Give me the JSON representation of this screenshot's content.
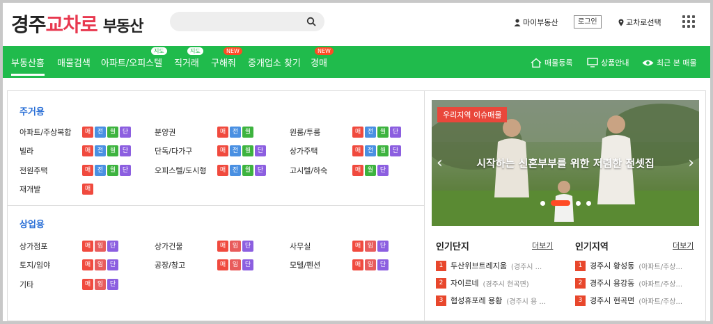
{
  "header": {
    "logo_part1": "경주",
    "logo_part2": "교차로",
    "logo_part3": "부동산",
    "search_placeholder": "",
    "my_realestate": "마이부동산",
    "login": "로그인",
    "region_select": "교차로선택"
  },
  "nav": {
    "items": [
      {
        "label": "부동산홈"
      },
      {
        "label": "매물검색"
      },
      {
        "label": "아파트/오피스텔",
        "badge": "지도"
      },
      {
        "label": "직거래",
        "badge": "지도"
      },
      {
        "label": "구해줘",
        "badge": "NEW"
      },
      {
        "label": "중개업소 찾기"
      },
      {
        "label": "경매",
        "badge": "NEW"
      }
    ],
    "right": {
      "register": "매물등록",
      "product_info": "상품안내",
      "recent": "최근 본 매물"
    }
  },
  "residential": {
    "title": "주거용",
    "items": [
      {
        "label": "아파트/주상복합",
        "tags": [
          "매",
          "전",
          "월",
          "단"
        ]
      },
      {
        "label": "분양권",
        "tags": [
          "매",
          "전",
          "월"
        ]
      },
      {
        "label": "원룸/투룸",
        "tags": [
          "매",
          "전",
          "월",
          "단"
        ]
      },
      {
        "label": "빌라",
        "tags": [
          "매",
          "전",
          "월",
          "단"
        ]
      },
      {
        "label": "단독/다가구",
        "tags": [
          "매",
          "전",
          "월",
          "단"
        ]
      },
      {
        "label": "상가주택",
        "tags": [
          "매",
          "전",
          "월",
          "단"
        ]
      },
      {
        "label": "전원주택",
        "tags": [
          "매",
          "전",
          "월",
          "단"
        ]
      },
      {
        "label": "오피스텔/도시형",
        "tags": [
          "매",
          "전",
          "월",
          "단"
        ]
      },
      {
        "label": "고시텔/하숙",
        "tags": [
          "매",
          "월",
          "단"
        ]
      },
      {
        "label": "재개발",
        "tags": [
          "매"
        ]
      }
    ]
  },
  "commercial": {
    "title": "상업용",
    "items": [
      {
        "label": "상가점포",
        "tags": [
          "매",
          "임",
          "단"
        ]
      },
      {
        "label": "상가건물",
        "tags": [
          "매",
          "임",
          "단"
        ]
      },
      {
        "label": "사무실",
        "tags": [
          "매",
          "임",
          "단"
        ]
      },
      {
        "label": "토지/임야",
        "tags": [
          "매",
          "임",
          "단"
        ]
      },
      {
        "label": "공장/창고",
        "tags": [
          "매",
          "임",
          "단"
        ]
      },
      {
        "label": "모텔/펜션",
        "tags": [
          "매",
          "임",
          "단"
        ]
      },
      {
        "label": "기타",
        "tags": [
          "매",
          "임",
          "단"
        ]
      }
    ]
  },
  "banner": {
    "tag": "우리지역 이슈매물",
    "text": "시작하는 신혼부부를 위한 저렴한 전셋집"
  },
  "popular_complex": {
    "title": "인기단지",
    "more": "더보기",
    "items": [
      {
        "rank": "1",
        "name": "두산위브트레지움",
        "sub": "(경주시 ..."
      },
      {
        "rank": "2",
        "name": "자이르네",
        "sub": "(경주시 현곡면)"
      },
      {
        "rank": "3",
        "name": "협성휴포레 용황",
        "sub": "(경주시 용 ..."
      }
    ]
  },
  "popular_region": {
    "title": "인기지역",
    "more": "더보기",
    "items": [
      {
        "rank": "1",
        "name": "경주시 황성동",
        "sub": "(아파트/주상..."
      },
      {
        "rank": "2",
        "name": "경주시 용강동",
        "sub": "(아파트/주상..."
      },
      {
        "rank": "3",
        "name": "경주시 현곡면",
        "sub": "(아파트/주상..."
      }
    ]
  }
}
